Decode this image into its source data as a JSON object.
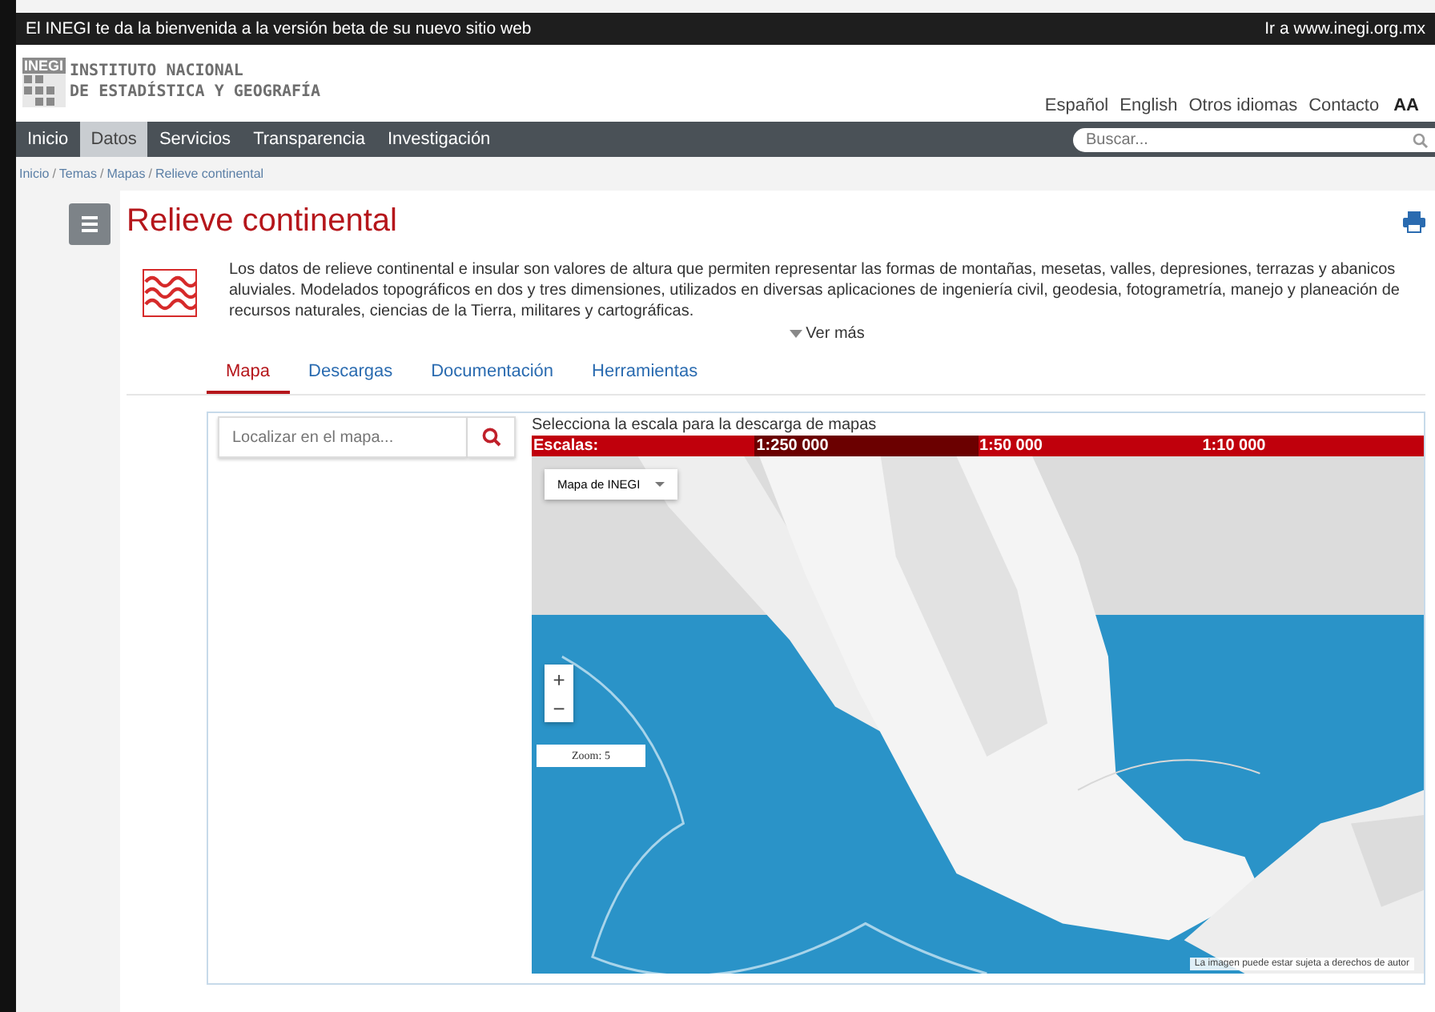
{
  "top_bar": {
    "welcome": "El INEGI te da la bienvenida a la versión beta de su nuevo sitio web",
    "link": "Ir a www.inegi.org.mx"
  },
  "header": {
    "logo_mark": "INEGI",
    "org_line_1": "INSTITUTO NACIONAL",
    "org_line_2": "DE ESTADÍSTICA Y GEOGRAFÍA",
    "links": [
      "Español",
      "English",
      "Otros idiomas",
      "Contacto"
    ],
    "font_size_toggle": "AA"
  },
  "nav": {
    "items": [
      {
        "label": "Inicio",
        "selected": false
      },
      {
        "label": "Datos",
        "selected": true
      },
      {
        "label": "Servicios",
        "selected": false
      },
      {
        "label": "Transparencia",
        "selected": false
      },
      {
        "label": "Investigación",
        "selected": false
      }
    ],
    "search": {
      "placeholder": "Buscar..."
    }
  },
  "breadcrumb": [
    {
      "label": "Inicio"
    },
    {
      "separator": "/",
      "label": "Temas"
    },
    {
      "separator": "/",
      "label": "Mapas"
    },
    {
      "separator": "/",
      "label": "Relieve continental"
    }
  ],
  "page": {
    "title": "Relieve continental",
    "description": "Los datos de relieve continental e insular son valores de altura que permiten representar las formas de montañas, mesetas, valles, depresiones, terrazas y abanicos aluviales. Modelados topográficos en dos y tres dimensiones, utilizados en diversas aplicaciones de ingeniería civil, geodesia, fotogrametría, manejo y planeación de recursos naturales, ciencias de la Tierra, militares y cartográficas.",
    "more": "Ver más"
  },
  "tabs": [
    {
      "label": "Mapa",
      "selected": true
    },
    {
      "label": "Descargas",
      "selected": false
    },
    {
      "label": "Documentación",
      "selected": false
    },
    {
      "label": "Herramientas",
      "selected": false
    }
  ],
  "locate": {
    "placeholder": "Localizar en el mapa..."
  },
  "scales": {
    "hint": "Selecciona la escala para la descarga de mapas",
    "items": [
      {
        "label": "Escalas:",
        "selected": false
      },
      {
        "label": "1:250 000",
        "selected": true
      },
      {
        "label": "1:50 000",
        "selected": false
      },
      {
        "label": "1:10 000",
        "selected": false
      }
    ]
  },
  "map": {
    "kind": "picture",
    "layer": "Mapa de INEGI",
    "zoom_in": "+",
    "zoom_out": "−",
    "zoom": "Zoom: 5",
    "attribution": "La imagen puede estar sujeta a derechos de autor"
  }
}
